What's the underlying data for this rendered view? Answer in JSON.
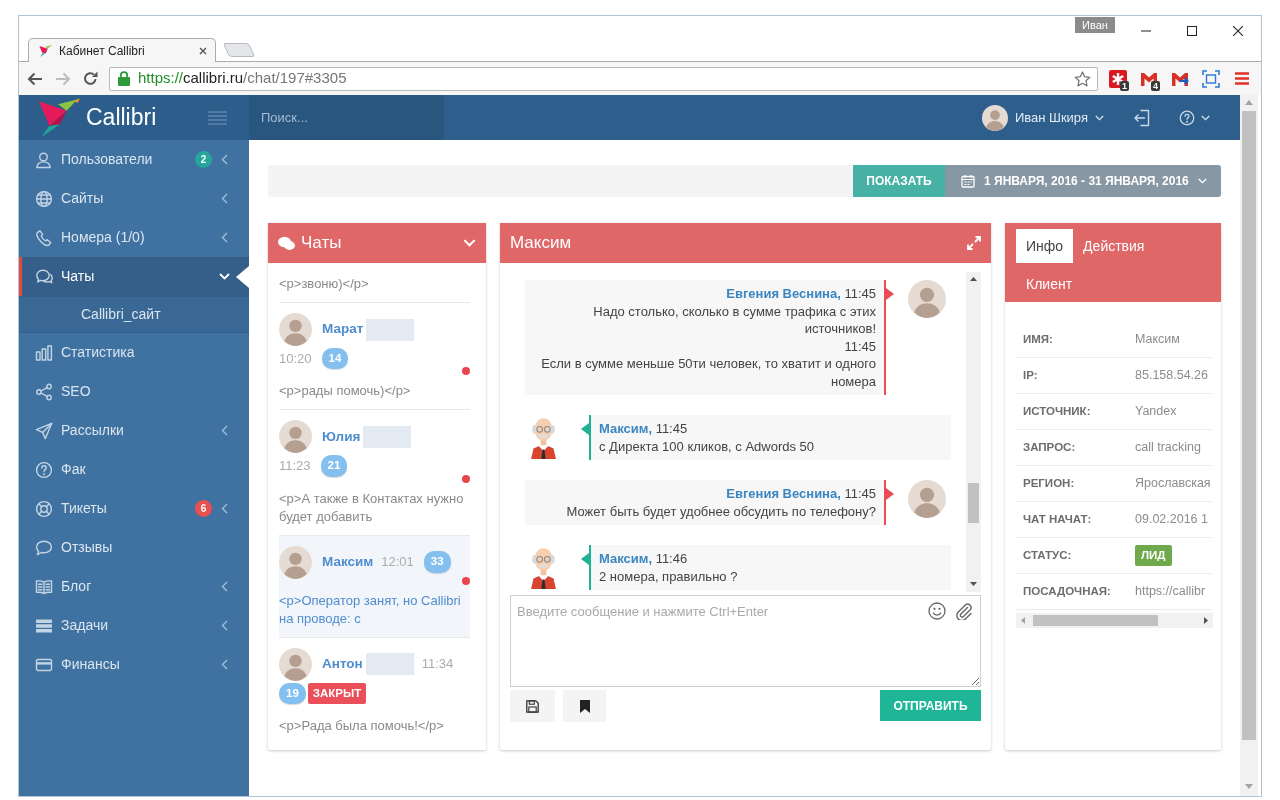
{
  "browser": {
    "profile": "Иван",
    "tab_title": "Кабинет Callibri",
    "url": {
      "scheme": "https://",
      "host": "callibri.ru",
      "path": "/chat/197#3305"
    },
    "extensions": [
      {
        "kind": "asterisk",
        "badge": "1"
      },
      {
        "kind": "mail",
        "badge": "4"
      },
      {
        "kind": "send"
      },
      {
        "kind": "capture"
      }
    ]
  },
  "app": {
    "logo": "Callibri",
    "search_placeholder": "Поиск...",
    "user_name": "Иван Шкиря"
  },
  "sidebar": {
    "items": [
      {
        "label": "Пользователи",
        "kind": "menu",
        "badge": {
          "text": "2",
          "color": "#26a69a"
        },
        "expanded": false,
        "selected": false
      },
      {
        "label": "Сайты",
        "kind": "menu",
        "expanded": false,
        "selected": false
      },
      {
        "label": "Номера (1/0)",
        "kind": "menu",
        "expanded": false,
        "selected": false
      },
      {
        "label": "Чаты",
        "kind": "menu",
        "expanded": true,
        "selected": true,
        "children": [
          {
            "label": "Callibri_сайт",
            "selected": false
          }
        ]
      },
      {
        "label": "Статистика",
        "kind": "link",
        "expanded": false,
        "selected": false
      },
      {
        "label": "SEO",
        "kind": "link",
        "expanded": false,
        "selected": false
      },
      {
        "label": "Рассылки",
        "kind": "menu",
        "expanded": false,
        "selected": false
      },
      {
        "label": "Фак",
        "kind": "link",
        "expanded": false,
        "selected": false
      },
      {
        "label": "Тикеты",
        "kind": "menu",
        "badge": {
          "text": "6",
          "color": "#e9504f"
        },
        "expanded": false,
        "selected": false
      },
      {
        "label": "Отзывы",
        "kind": "link",
        "expanded": false,
        "selected": false
      },
      {
        "label": "Блог",
        "kind": "menu",
        "expanded": false,
        "selected": false
      },
      {
        "label": "Задачи",
        "kind": "menu",
        "expanded": false,
        "selected": false
      },
      {
        "label": "Финансы",
        "kind": "menu",
        "expanded": false,
        "selected": false
      }
    ]
  },
  "filter": {
    "show_button": "ПОКАЗАТЬ",
    "date_range": "1 ЯНВАРЯ, 2016 - 31 ЯНВАРЯ, 2016"
  },
  "chats": {
    "title": "Чаты",
    "items": [
      {
        "selected": false,
        "preview": "<p>звоню)</p>"
      },
      {
        "name": "Марат",
        "redacted": true,
        "time": "10:20",
        "count": "14",
        "unread": true,
        "selected": false,
        "preview": "<p>рады помочь)</p>"
      },
      {
        "name": "Юлия",
        "redacted": true,
        "time": "11:23",
        "count": "21",
        "unread": true,
        "selected": false,
        "preview": "<p>А также в Контактах нужно будет добавить"
      },
      {
        "name": "Максим",
        "redacted": false,
        "time": "12:01",
        "count": "33",
        "unread": true,
        "selected": true,
        "preview": "<p>Оператор занят, но Callibri на проводе: с"
      },
      {
        "name": "Антон",
        "redacted": true,
        "time": "11:34",
        "count": "19",
        "tag": "ЗАКРЫТ",
        "unread": false,
        "selected": false,
        "preview": "<p>Рада была помочь!</p>"
      }
    ]
  },
  "chat": {
    "title": "Максим",
    "messages": [
      {
        "kind": "operator",
        "header": "**Евгения Веснина,** 11:45",
        "lines": [
          "Надо столько, сколько в сумме трафика с этих источников!",
          "11:45",
          "Если в сумме меньше 50ти человек, то хватит и одного номера"
        ]
      },
      {
        "kind": "client",
        "header": "**Максим,** 11:45",
        "lines": [
          "с Директа 100 кликов, с Adwords 50"
        ]
      },
      {
        "kind": "operator",
        "header": "**Евгения Веснина,** 11:45",
        "lines": [
          "Может быть будет удобнее обсудить по телефону?"
        ]
      },
      {
        "kind": "client",
        "header": "**Максим,** 11:46",
        "lines": [
          "2 номера, правильно ?"
        ]
      }
    ],
    "input_placeholder": "Введите сообщение и нажмите Ctrl+Enter",
    "send_button": "ОТПРАВИТЬ"
  },
  "info": {
    "tabs": [
      {
        "label": "Инфо",
        "selected": true
      },
      {
        "label": "Действия",
        "selected": false
      },
      {
        "label": "Клиент",
        "selected": false
      }
    ],
    "fields": [
      {
        "kind": "text",
        "label": "ИМЯ:",
        "value": "Максим"
      },
      {
        "kind": "text",
        "label": "IP:",
        "value": "85.158.54.26"
      },
      {
        "kind": "text",
        "label": "ИСТОЧНИК:",
        "value": "Yandex"
      },
      {
        "kind": "text",
        "label": "ЗАПРОС:",
        "value": "call tracking"
      },
      {
        "kind": "text",
        "label": "РЕГИОН:",
        "value": "Ярославская"
      },
      {
        "kind": "text",
        "label": "ЧАТ НАЧАТ:",
        "value": "09.02.2016 1"
      },
      {
        "kind": "badge",
        "label": "СТАТУС:",
        "value": "ЛИД"
      },
      {
        "kind": "text",
        "label": "ПОСАДОЧНАЯ:",
        "value": "https://callibr"
      }
    ]
  }
}
